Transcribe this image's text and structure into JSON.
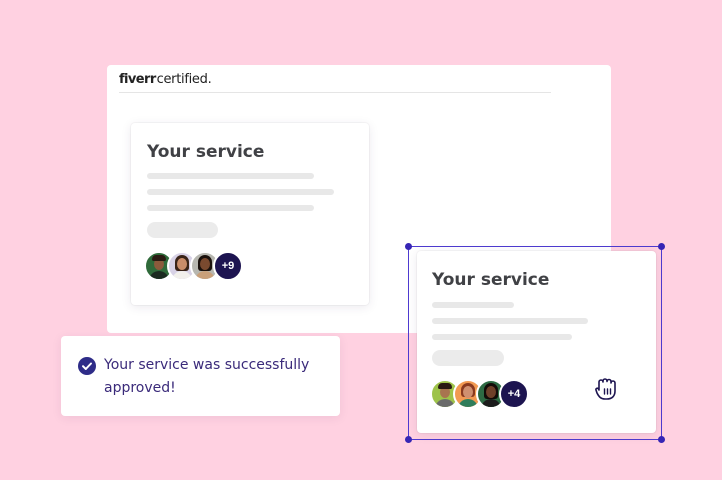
{
  "brand": {
    "logo": "fiverr",
    "suffix": "certified."
  },
  "cards": [
    {
      "title": "Your service",
      "more_count": "+9"
    },
    {
      "title": "Your service",
      "more_count": "+4"
    }
  ],
  "toast": {
    "message": "Your service was successfully approved!",
    "icon": "check-circle-icon"
  },
  "cursor": {
    "icon": "grab-hand-icon"
  },
  "colors": {
    "background": "#ffd1e1",
    "accent": "#3625b5",
    "badge": "#1d1450",
    "toast_text": "#3a2a7a"
  }
}
